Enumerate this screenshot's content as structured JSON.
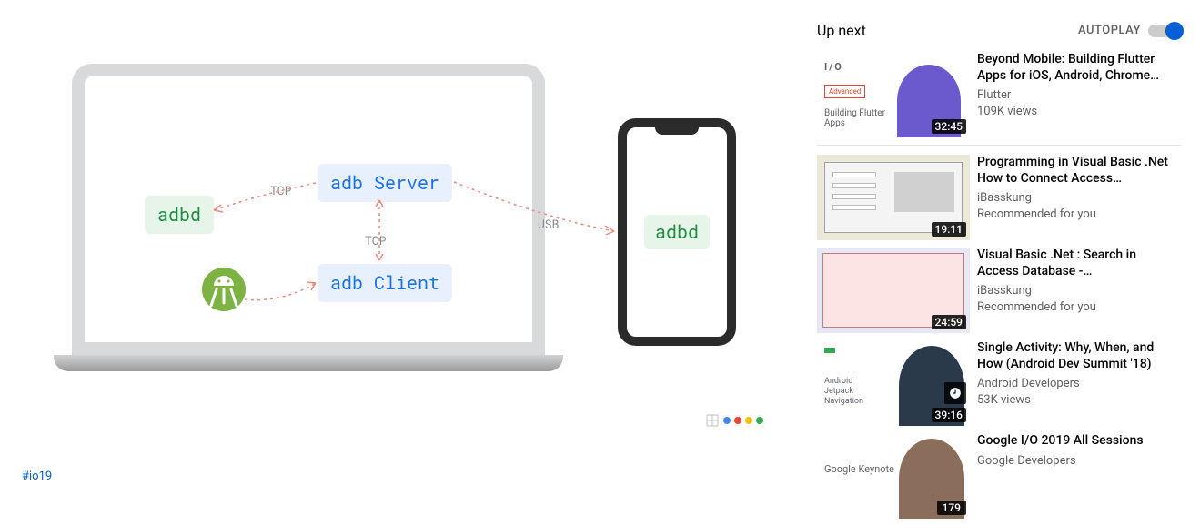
{
  "video": {
    "hashtag": "#io19",
    "diagram": {
      "adbd_emulator": "adbd",
      "adb_server": "adb Server",
      "adb_client": "adb Client",
      "adbd_phone": "adbd",
      "label_tcp1": "TCP",
      "label_tcp2": "TCP",
      "label_usb": "USB"
    }
  },
  "sidebar": {
    "up_next": "Up next",
    "autoplay_label": "AUTOPLAY",
    "items": [
      {
        "title": "Beyond Mobile: Building Flutter Apps for iOS, Android, Chrome…",
        "channel": "Flutter",
        "meta": "109K views",
        "duration": "32:45",
        "thumb_tag": "Advanced",
        "thumb_text": "Building Flutter Apps"
      },
      {
        "title": "Programming in Visual Basic .Net How to Connect Access…",
        "channel": "iBasskung",
        "meta": "Recommended for you",
        "duration": "19:11"
      },
      {
        "title": "Visual Basic .Net : Search in Access Database -…",
        "channel": "iBasskung",
        "meta": "Recommended for you",
        "duration": "24:59"
      },
      {
        "title": "Single Activity: Why, When, and How (Android Dev Summit '18)",
        "channel": "Android Developers",
        "meta": "53K views",
        "duration": "39:16",
        "thumb_text": "Android Jetpack Navigation"
      },
      {
        "title": "Google I/O 2019 All Sessions",
        "channel": "Google Developers",
        "badge": "179",
        "thumb_text": "Google Keynote"
      }
    ]
  }
}
